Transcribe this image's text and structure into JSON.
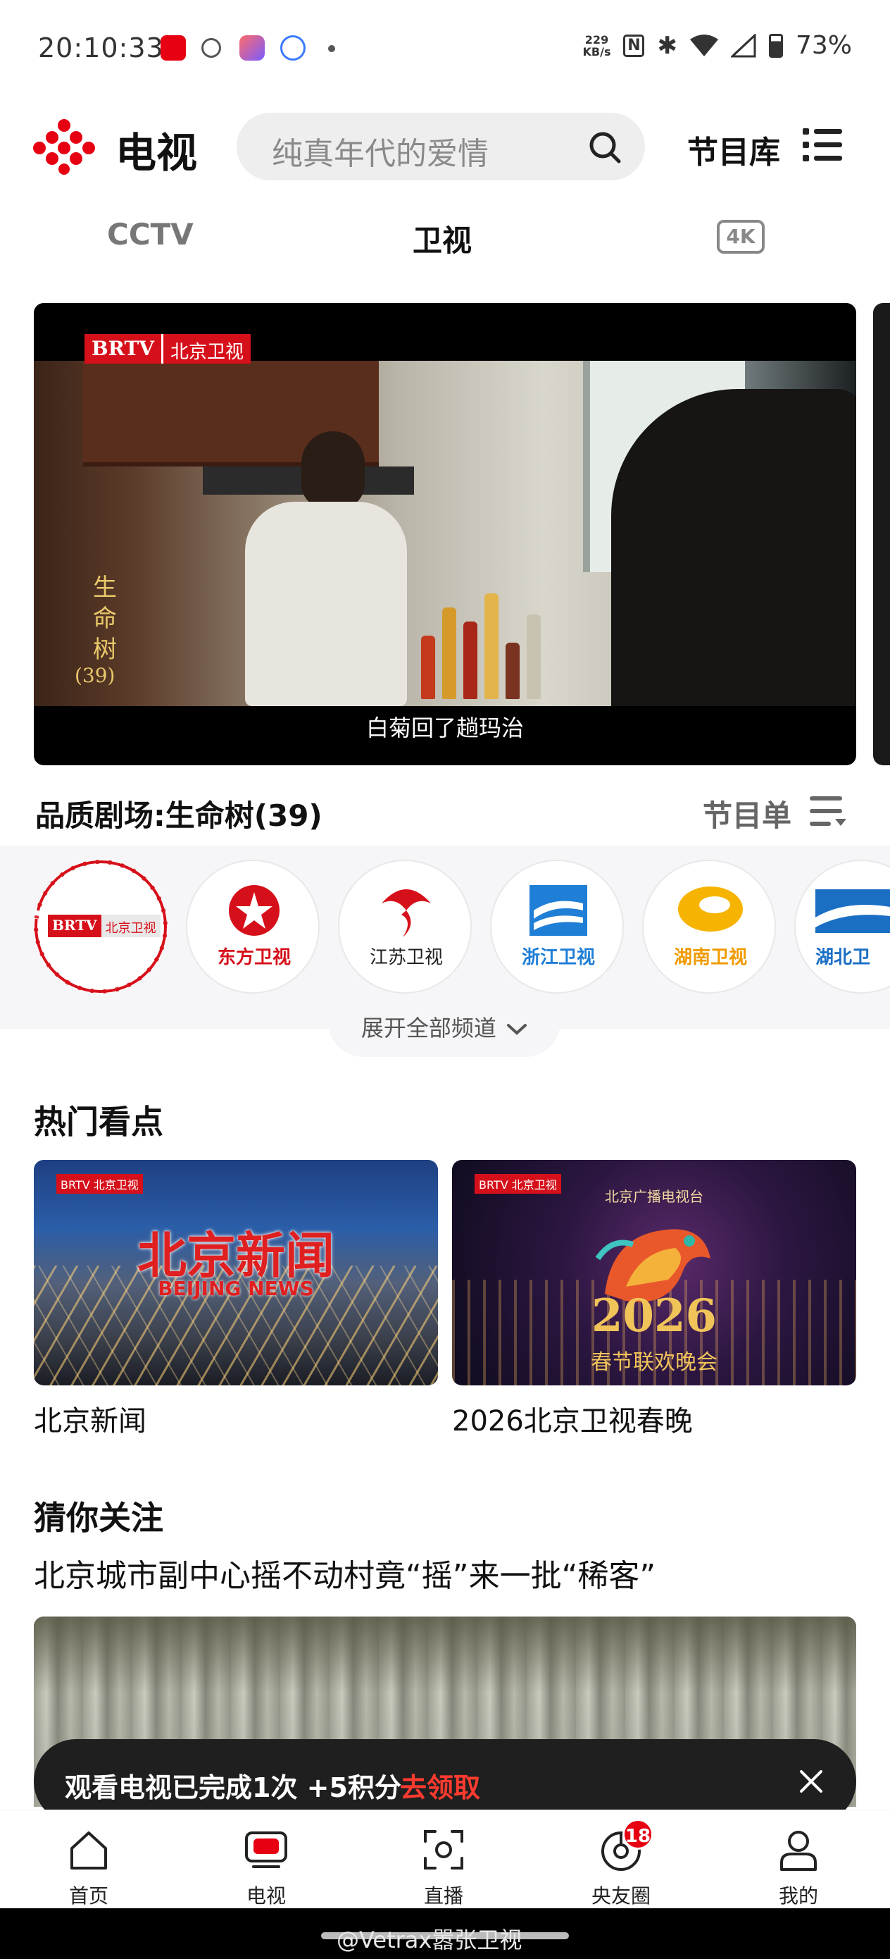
{
  "status_bar": {
    "time": "20:10:33",
    "net_speed_top": "229",
    "net_speed_bottom": "KB/s",
    "battery": "73%"
  },
  "header": {
    "app_title": "电视",
    "search_placeholder": "纯真年代的爱情",
    "library_label": "节目库"
  },
  "tabs": {
    "cctv": "CCTV",
    "weishi": "卫视",
    "fourk": "4K"
  },
  "player": {
    "channel_badge_brand": "BRTV",
    "channel_badge_name": "北京卫视",
    "program_vertical": "生命树",
    "program_episode": "(39)",
    "subtitle": "白菊回了趟玛治"
  },
  "now_playing": {
    "title": "品质剧场:生命树(39)",
    "schedule_label": "节目单"
  },
  "channels": [
    {
      "name": "北京卫视",
      "brand": "BRTV"
    },
    {
      "name": "东方卫视"
    },
    {
      "name": "江苏卫视"
    },
    {
      "name": "浙江卫视"
    },
    {
      "name": "湖南卫视"
    },
    {
      "name": "湖北卫"
    }
  ],
  "expand_label": "展开全部频道",
  "hot": {
    "title": "热门看点",
    "items": [
      {
        "caption": "北京新闻",
        "image_title": "北京新闻",
        "image_subtitle": "BEIJING NEWS",
        "badge": "BRTV 北京卫视"
      },
      {
        "caption": "2026北京卫视春晚",
        "image_title": "2026",
        "image_subtitle": "春节联欢晚会",
        "badge": "BRTV 北京卫视",
        "image_top": "北京广播电视台"
      }
    ]
  },
  "guess": {
    "title": "猜你关注",
    "headline": "北京城市副中心摇不动村竟“摇”来一批“稀客”"
  },
  "toast": {
    "text": "观看电视已完成1次 +5积分",
    "action": "去领取"
  },
  "bottom_nav": {
    "items": [
      {
        "label": "首页",
        "icon": "home-icon"
      },
      {
        "label": "电视",
        "icon": "tv-icon"
      },
      {
        "label": "直播",
        "icon": "live-icon"
      },
      {
        "label": "央友圈",
        "icon": "circle-icon",
        "badge": "18"
      },
      {
        "label": "我的",
        "icon": "profile-icon"
      }
    ]
  },
  "watermark": "@Vetrax嚣张卫视",
  "colors": {
    "brand_red": "#e60012",
    "toast_bg": "#1f1f1f",
    "tab_active": "#111111",
    "tab_inactive": "#777777"
  }
}
